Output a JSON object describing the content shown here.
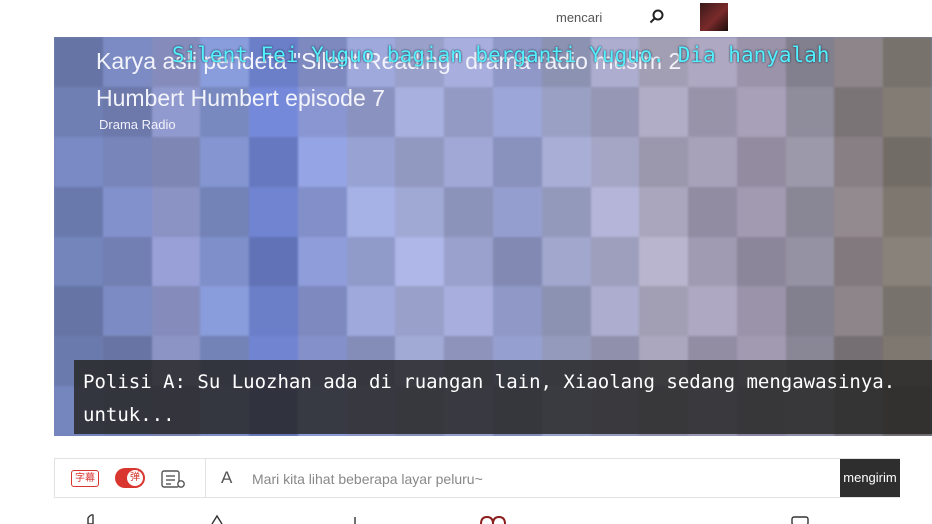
{
  "header": {
    "search_label": "mencari",
    "search_icon": "search-icon",
    "avatar_icon": "avatar"
  },
  "player": {
    "title": "Karya asli pendeta \"Silent Reading\" drama radio musim 2 Humbert Humbert episode 7",
    "category": "Drama Radio",
    "danmaku": "Silent Fei Yuguo bagian berganti Yuguo. Dia hanyalah",
    "subtitle_line1": "Polisi A: Su Luozhan ada di ruangan lain, Xiaolang sedang mengawasinya.",
    "subtitle_line2": "untuk...",
    "mosaic_colors": [
      "#6f7fb4",
      "#7785bb",
      "#8b93c5",
      "#7e8fc9",
      "#6b7ec8",
      "#8996d2",
      "#98a2d3",
      "#a0a8d4",
      "#9aa1cc",
      "#8f98c6",
      "#9aa0c4",
      "#a5a6c6",
      "#aaa6bd",
      "#a09ab2",
      "#9a93a9",
      "#8f8c9c",
      "#877f83",
      "#7d7770"
    ]
  },
  "danmaku_bar": {
    "subtitle_btn": "字幕",
    "toggle_btn": "弹",
    "font_icon": "A",
    "placeholder": "Mari kita lihat beberapa layar peluru~",
    "send_label": "mengirim"
  },
  "colors": {
    "accent": "#d8362f",
    "danmaku": "#53f0ff",
    "send_bg": "#2e2e2e"
  }
}
